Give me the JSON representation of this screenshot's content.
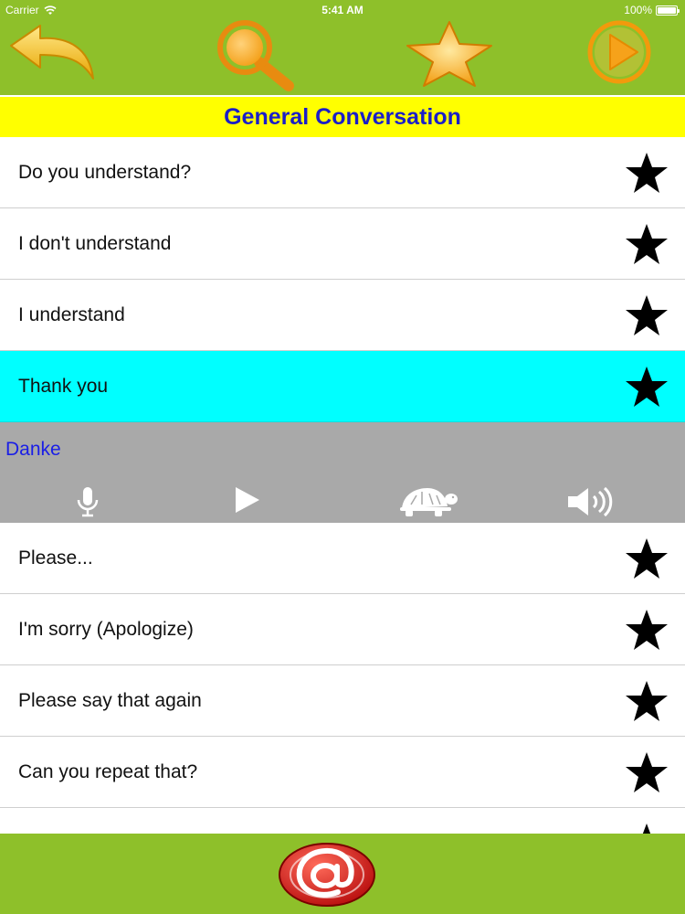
{
  "status_bar": {
    "carrier": "Carrier",
    "time": "5:41 AM",
    "battery": "100%"
  },
  "toolbar": {
    "buttons": [
      {
        "icon": "back-arrow-icon"
      },
      {
        "icon": "magnifier-icon"
      },
      {
        "icon": "star-icon"
      },
      {
        "icon": "play-circle-icon"
      }
    ]
  },
  "title": "General Conversation",
  "phrases": [
    {
      "label": "Do you understand?",
      "selected": false
    },
    {
      "label": "I don't understand",
      "selected": false
    },
    {
      "label": "I understand",
      "selected": false
    },
    {
      "label": "Thank you",
      "selected": true
    },
    {
      "label": "Please...",
      "selected": false
    },
    {
      "label": "I'm sorry (Apologize)",
      "selected": false
    },
    {
      "label": "Please say that again",
      "selected": false
    },
    {
      "label": "Can you repeat that?",
      "selected": false
    }
  ],
  "detail": {
    "translation": "Danke",
    "controls": [
      "microphone-icon",
      "play-icon",
      "turtle-slow-icon",
      "speaker-icon"
    ]
  },
  "bottom_bar": {
    "icon": "email-at-icon"
  },
  "colors": {
    "bar_green": "#8ec02a",
    "title_yellow": "#ffff00",
    "title_blue": "#1a1ec8",
    "selected_cyan": "#00ffff",
    "detail_gray": "#a9a9a9",
    "icon_orange": "#f5a01a"
  }
}
